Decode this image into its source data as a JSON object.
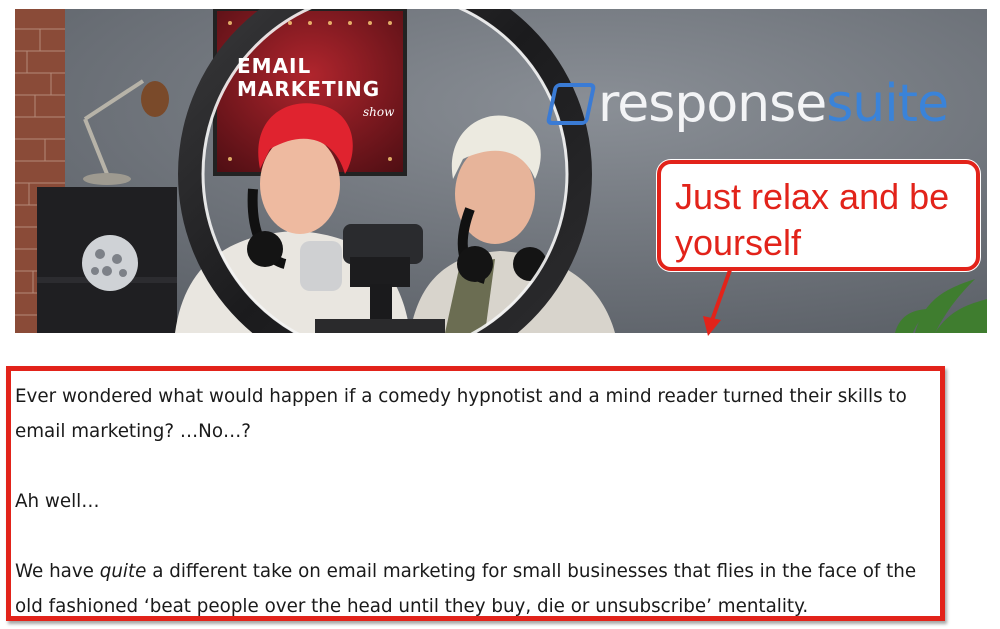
{
  "hero": {
    "poster_text": "EMAIL\nMARKETING",
    "poster_show": "show",
    "brand_part1": "response",
    "brand_part2": "suite"
  },
  "callout": {
    "text": "Just relax and be yourself"
  },
  "article": {
    "p1": "Ever wondered what would happen if a comedy hypnotist and a mind reader turned their skills to email marketing? …No…?",
    "p2": "Ah well…",
    "p3_before": "We have ",
    "p3_emphasis": "quite",
    "p3_after": " a different take on email marketing for small businesses that flies in the face of the old fashioned ‘beat people over the head until they buy, die or unsubscribe’ mentality."
  },
  "colors": {
    "accent_red": "#e2231a",
    "brand_blue": "#3a83d9"
  }
}
